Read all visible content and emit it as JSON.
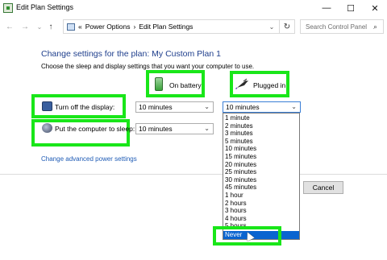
{
  "window": {
    "title": "Edit Plan Settings",
    "minimize_glyph": "—",
    "maximize_glyph": "☐",
    "close_glyph": "✕"
  },
  "nav": {
    "back_glyph": "←",
    "forward_glyph": "→",
    "recent_glyph": "⌄",
    "up_glyph": "↑",
    "refresh_glyph": "↻",
    "dropdown_glyph": "⌄",
    "separator": "«",
    "crumbs": [
      "Power Options",
      "Edit Plan Settings"
    ],
    "crumb_arrow": "›",
    "search_placeholder": "Search Control Panel",
    "search_glyph": "⌕"
  },
  "page": {
    "heading": "Change settings for the plan: My Custom Plan 1",
    "subtext": "Choose the sleep and display settings that you want your computer to use.",
    "col_battery": "On battery",
    "col_plugged": "Plugged in",
    "row_display": "Turn off the display:",
    "row_sleep": "Put the computer to sleep:",
    "display_battery_value": "10 minutes",
    "display_plugged_value": "10 minutes",
    "sleep_battery_value": "10 minutes",
    "advanced_link": "Change advanced power settings",
    "cancel_label": "Cancel",
    "chevron_glyph": "⌄"
  },
  "dropdown": {
    "options": [
      "1 minute",
      "2 minutes",
      "3 minutes",
      "5 minutes",
      "10 minutes",
      "15 minutes",
      "20 minutes",
      "25 minutes",
      "30 minutes",
      "45 minutes",
      "1 hour",
      "2 hours",
      "3 hours",
      "4 hours",
      "5 hours",
      "Never"
    ],
    "highlighted": "Never"
  },
  "colors": {
    "highlight_box": "#19e619",
    "heading": "#1e3e8c",
    "link": "#1e5bb5",
    "selection": "#0a64d0"
  },
  "icons": {
    "app": "power-options-icon",
    "battery": "battery-icon",
    "plug": "power-plug-icon",
    "display": "monitor-icon",
    "sleep": "moon-sleep-icon"
  }
}
